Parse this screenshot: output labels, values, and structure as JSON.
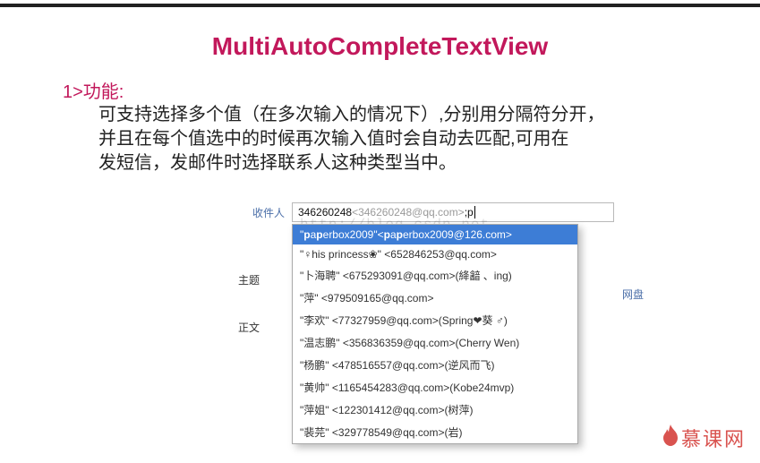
{
  "title": "MultiAutoCompleteTextView",
  "section_label": "1>功能:",
  "description": "可支持选择多个值（在多次输入的情况下）,分别用分隔符分开，\n并且在每个值选中的时候再次输入值时会自动去匹配,可用在\n发短信，发邮件时选择联系人这种类型当中。",
  "form": {
    "recipient_label": "收件人",
    "subject_label": "主题",
    "body_label": "正文",
    "input_prefix": "346260248",
    "input_gray": "<346260248@qq.com>",
    "input_sep": "; ",
    "input_typed": "p",
    "side_tab": "网盘"
  },
  "dropdown": {
    "selected": "\"paperbox2009\"<paperbox2009@126.com>",
    "items": [
      "\"♀his princess❀\" <652846253@qq.com>",
      "\"卜海聘\" <675293091@qq.com>(絳韽 、ing)",
      "\"萍\" <979509165@qq.com>",
      "\"李欢\" <77327959@qq.com>(Spring❤葵 ♂)",
      "\"温志鹏\" <356836359@qq.com>(Cherry Wen)",
      "\"杨鹏\" <478516557@qq.com>(逆风而飞)",
      "\"黄帅\" <1165454283@qq.com>(Kobe24mvp)",
      "\"萍姐\" <122301412@qq.com>(树萍)",
      "\"裴芫\" <329778549@qq.com>(岩)"
    ]
  },
  "watermark": "http://blog.csdn.net",
  "brand": "慕课网"
}
